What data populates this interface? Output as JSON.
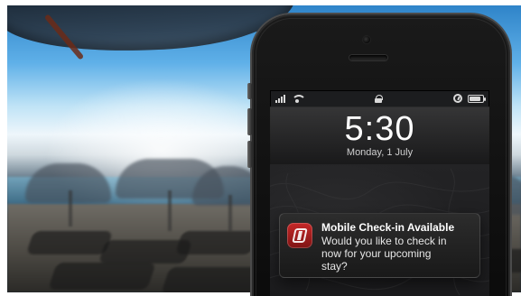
{
  "lock_screen": {
    "time": "5:30",
    "date": "Monday, 1 July"
  },
  "status_bar": {
    "signal_bars": 4,
    "battery_level": 0.85,
    "icons": [
      "signal-icon",
      "wifi-icon",
      "lock-icon",
      "alarm-icon",
      "battery-icon"
    ]
  },
  "notification": {
    "title": "Mobile Check-in Available",
    "body_lines": [
      "Would you like to check in",
      "now for your upcoming",
      "stay?"
    ],
    "app_icon": "hotel-app-icon",
    "app_icon_color": "#c62828"
  }
}
